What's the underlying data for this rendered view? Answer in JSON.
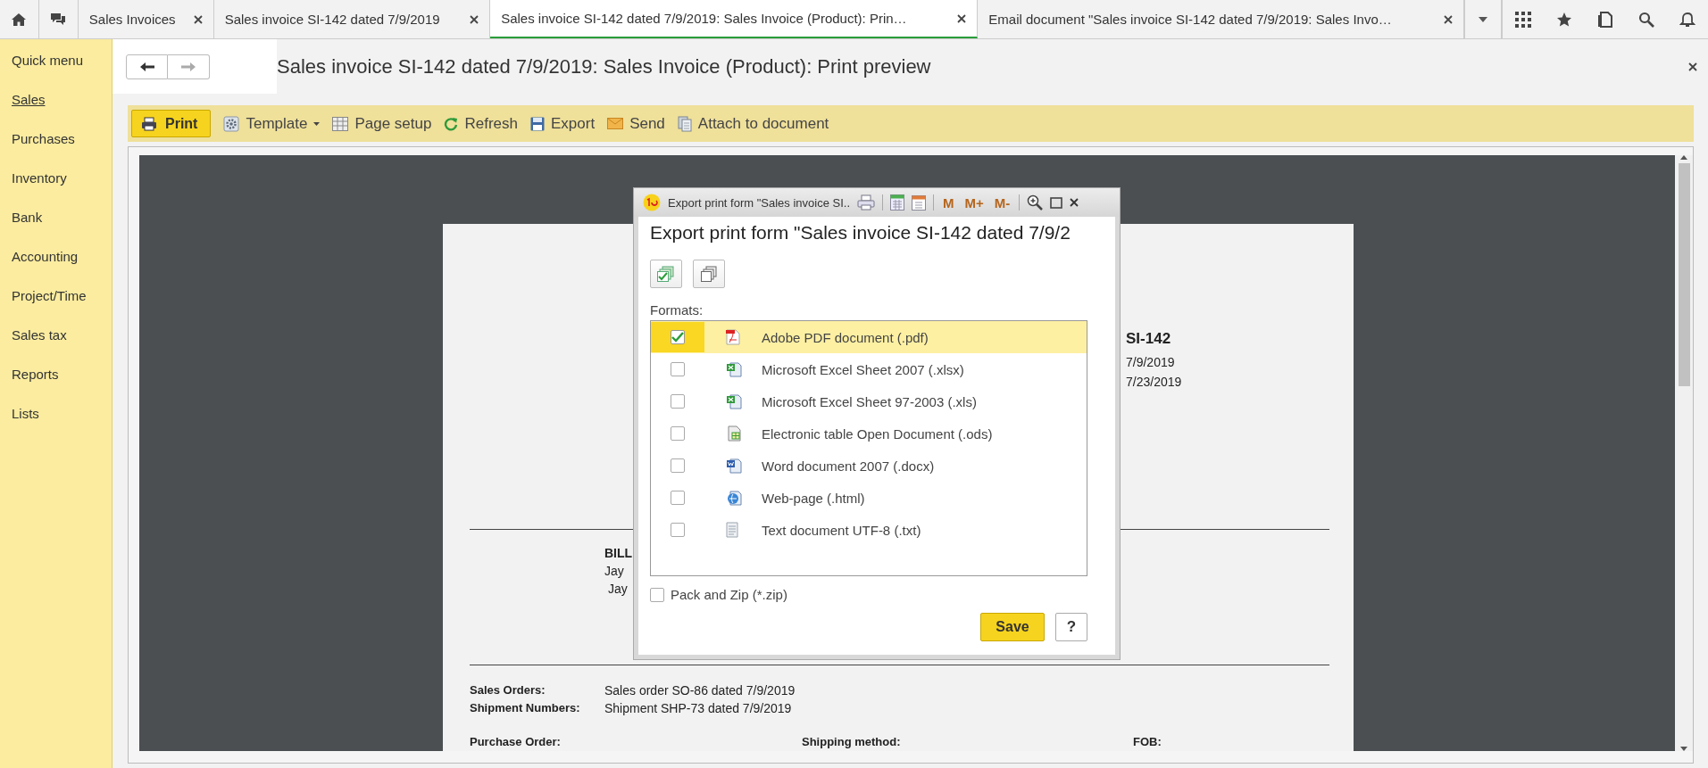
{
  "tabs": [
    {
      "label": "Sales Invoices",
      "selected": false
    },
    {
      "label": "Sales invoice SI-142 dated 7/9/2019",
      "selected": false
    },
    {
      "label": "Sales invoice SI-142 dated 7/9/2019: Sales Invoice (Product): Prin…",
      "selected": true
    },
    {
      "label": "Email document \"Sales invoice SI-142 dated 7/9/2019: Sales Invo…",
      "selected": false
    }
  ],
  "sidebar": {
    "items": [
      {
        "label": "Quick menu",
        "selected": false
      },
      {
        "label": "Sales",
        "selected": true
      },
      {
        "label": "Purchases",
        "selected": false
      },
      {
        "label": "Inventory",
        "selected": false
      },
      {
        "label": "Bank",
        "selected": false
      },
      {
        "label": "Accounting",
        "selected": false
      },
      {
        "label": "Project/Time",
        "selected": false
      },
      {
        "label": "Sales tax",
        "selected": false
      },
      {
        "label": "Reports",
        "selected": false
      },
      {
        "label": "Lists",
        "selected": false
      }
    ]
  },
  "page": {
    "title": "Sales invoice SI-142 dated 7/9/2019: Sales Invoice (Product): Print preview"
  },
  "toolbar": [
    {
      "label": "Print",
      "kind": "primary"
    },
    {
      "label": "Template",
      "kind": "menu"
    },
    {
      "label": "Page setup",
      "kind": "plain"
    },
    {
      "label": "Refresh",
      "kind": "plain"
    },
    {
      "label": "Export",
      "kind": "plain"
    },
    {
      "label": "Send",
      "kind": "plain"
    },
    {
      "label": "Attach to document",
      "kind": "plain"
    }
  ],
  "document": {
    "number": "SI-142",
    "dates": [
      "7/9/2019",
      "7/23/2019"
    ],
    "bill_to": [
      "BILL",
      "Jay",
      "Jay"
    ],
    "orders": [
      {
        "label": "Sales Orders:",
        "value": "Sales order SO-86 dated 7/9/2019"
      },
      {
        "label": "Shipment Numbers:",
        "value": "Shipment SHP-73 dated 7/9/2019"
      }
    ],
    "footer_labels": [
      "Purchase Order:",
      "Shipping method:",
      "FOB:"
    ]
  },
  "dialog": {
    "title": "Export print form \"Sales invoice SI..",
    "memory_buttons": [
      "M",
      "M+",
      "M-"
    ],
    "heading": "Export print form \"Sales invoice SI-142 dated 7/9/2",
    "formats_label": "Formats:",
    "formats": [
      {
        "label": "Adobe PDF document (.pdf)",
        "checked": true,
        "selected": true
      },
      {
        "label": "Microsoft Excel Sheet 2007 (.xlsx)",
        "checked": false,
        "selected": false
      },
      {
        "label": "Microsoft Excel Sheet 97-2003 (.xls)",
        "checked": false,
        "selected": false
      },
      {
        "label": "Electronic table Open Document (.ods)",
        "checked": false,
        "selected": false
      },
      {
        "label": "Word document 2007 (.docx)",
        "checked": false,
        "selected": false
      },
      {
        "label": "Web-page (.html)",
        "checked": false,
        "selected": false
      },
      {
        "label": "Text document UTF-8 (.txt)",
        "checked": false,
        "selected": false
      }
    ],
    "pack_zip": {
      "label": "Pack and Zip (*.zip)",
      "checked": false
    },
    "buttons": [
      "Save",
      "?"
    ]
  }
}
